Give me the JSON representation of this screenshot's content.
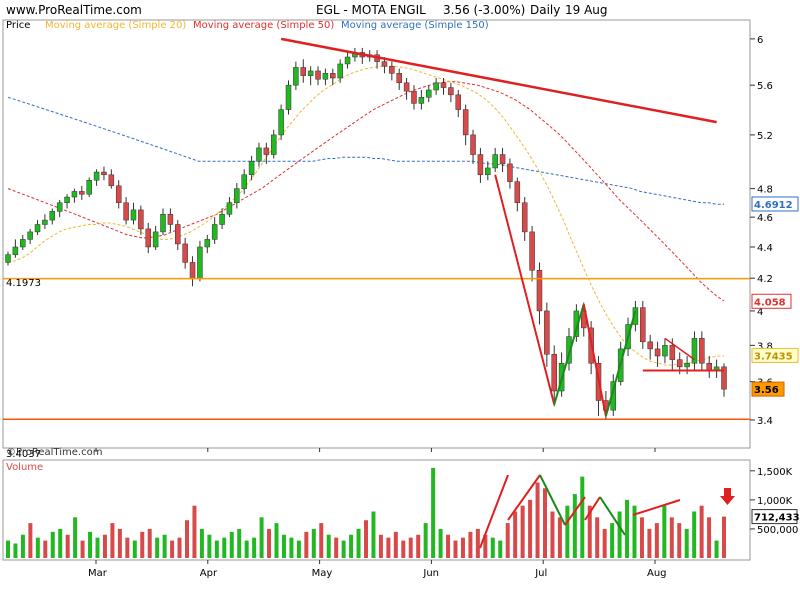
{
  "header": {
    "site": "www.ProRealTime.com",
    "title": "EGL - MOTA ENGIL",
    "price": "3.56 (-3.00%)",
    "period": "Daily",
    "date": "19 Aug"
  },
  "watermark": "©ProRealTime.com",
  "colors": {
    "up": "#22b822",
    "down": "#d84a4a",
    "sma20": "#f0b830",
    "sma50": "#e03030",
    "sma150": "#3070c0",
    "trend": "#e02020",
    "support": "#ff9900",
    "support2": "#ff5500"
  },
  "chart_data": [
    {
      "type": "candlestick",
      "title": "EGL - MOTA ENGIL  3.56 (-3.00%)  Daily  19 Aug",
      "legend": [
        "Price",
        "Moving average (Simple 20)",
        "Moving average (Simple 50)",
        "Moving average (Simple 150)"
      ],
      "x_ticks": [
        "Mar",
        "Apr",
        "May",
        "Jun",
        "Jul",
        "Aug"
      ],
      "y_ticks": [
        "3.4",
        "3.6",
        "3.8",
        "4",
        "4.2",
        "4.4",
        "4.6",
        "4.8",
        "5.2",
        "5.6",
        "6"
      ],
      "ylim": [
        3.3,
        6.08
      ],
      "y_scale": "log",
      "price_labels": [
        {
          "name": "sma150",
          "value": "4.6912"
        },
        {
          "name": "sma50",
          "value": "4.058"
        },
        {
          "name": "sma20",
          "value": "3.7435"
        },
        {
          "name": "last",
          "value": "3.56"
        }
      ],
      "levels": [
        {
          "label": "4.1973",
          "value": 4.1973
        },
        {
          "label": "3.4037",
          "value": 3.4037
        }
      ],
      "sma20": [
        4.3,
        4.31,
        4.33,
        4.36,
        4.4,
        4.44,
        4.47,
        4.5,
        4.52,
        4.53,
        4.54,
        4.55,
        4.55,
        4.56,
        4.56,
        4.55,
        4.54,
        4.52,
        4.5,
        4.48,
        4.46,
        4.45,
        4.45,
        4.46,
        4.48,
        4.5,
        4.53,
        4.56,
        4.6,
        4.64,
        4.68,
        4.73,
        4.78,
        4.85,
        4.92,
        5.0,
        5.08,
        5.16,
        5.24,
        5.31,
        5.38,
        5.44,
        5.5,
        5.55,
        5.59,
        5.63,
        5.67,
        5.7,
        5.72,
        5.74,
        5.75,
        5.76,
        5.76,
        5.76,
        5.75,
        5.74,
        5.72,
        5.7,
        5.68,
        5.66,
        5.64,
        5.62,
        5.6,
        5.57,
        5.54,
        5.5,
        5.45,
        5.39,
        5.32,
        5.24,
        5.16,
        5.08,
        4.99,
        4.9,
        4.8,
        4.69,
        4.58,
        4.46,
        4.35,
        4.24,
        4.14,
        4.05,
        3.97,
        3.9,
        3.84,
        3.79,
        3.76,
        3.73,
        3.71,
        3.7,
        3.69,
        3.69,
        3.7,
        3.7,
        3.71,
        3.72,
        3.73,
        3.74,
        3.74
      ],
      "sma50": [
        4.8,
        4.78,
        4.76,
        4.74,
        4.72,
        4.7,
        4.68,
        4.66,
        4.64,
        4.62,
        4.6,
        4.58,
        4.56,
        4.54,
        4.52,
        4.5,
        4.48,
        4.47,
        4.46,
        4.46,
        4.47,
        4.48,
        4.5,
        4.52,
        4.54,
        4.56,
        4.58,
        4.6,
        4.62,
        4.65,
        4.68,
        4.71,
        4.74,
        4.77,
        4.8,
        4.84,
        4.88,
        4.92,
        4.96,
        5.0,
        5.04,
        5.08,
        5.12,
        5.16,
        5.2,
        5.24,
        5.28,
        5.32,
        5.36,
        5.4,
        5.43,
        5.46,
        5.49,
        5.52,
        5.55,
        5.57,
        5.59,
        5.61,
        5.62,
        5.63,
        5.63,
        5.62,
        5.61,
        5.6,
        5.58,
        5.56,
        5.54,
        5.51,
        5.48,
        5.44,
        5.4,
        5.35,
        5.3,
        5.25,
        5.2,
        5.14,
        5.08,
        5.02,
        4.96,
        4.9,
        4.84,
        4.78,
        4.72,
        4.67,
        4.62,
        4.57,
        4.52,
        4.47,
        4.42,
        4.37,
        4.32,
        4.27,
        4.22,
        4.17,
        4.13,
        4.09,
        4.06
      ],
      "sma150": [
        5.5,
        5.48,
        5.46,
        5.44,
        5.42,
        5.4,
        5.38,
        5.36,
        5.34,
        5.32,
        5.3,
        5.28,
        5.26,
        5.24,
        5.22,
        5.2,
        5.18,
        5.16,
        5.14,
        5.12,
        5.1,
        5.08,
        5.06,
        5.04,
        5.02,
        5.0,
        5.0,
        5.0,
        5.0,
        5.0,
        5.0,
        5.0,
        5.0,
        5.0,
        5.0,
        5.0,
        5.0,
        5.0,
        5.0,
        5.0,
        5.0,
        5.01,
        5.02,
        5.02,
        5.03,
        5.03,
        5.03,
        5.03,
        5.02,
        5.02,
        5.01,
        5.0,
        5.0,
        5.0,
        5.0,
        5.0,
        5.0,
        5.0,
        5.0,
        5.0,
        5.0,
        5.0,
        4.99,
        4.98,
        4.98,
        4.97,
        4.96,
        4.95,
        4.94,
        4.93,
        4.92,
        4.91,
        4.9,
        4.89,
        4.88,
        4.87,
        4.86,
        4.85,
        4.84,
        4.83,
        4.82,
        4.81,
        4.8,
        4.78,
        4.77,
        4.76,
        4.75,
        4.74,
        4.73,
        4.72,
        4.71,
        4.7,
        4.7,
        4.69,
        4.69
      ],
      "candles": [
        [
          4.3,
          4.35,
          4.28,
          4.37
        ],
        [
          4.35,
          4.4,
          4.33,
          4.45
        ],
        [
          4.4,
          4.45,
          4.38,
          4.48
        ],
        [
          4.45,
          4.5,
          4.42,
          4.52
        ],
        [
          4.5,
          4.55,
          4.48,
          4.58
        ],
        [
          4.55,
          4.58,
          4.52,
          4.62
        ],
        [
          4.58,
          4.64,
          4.55,
          4.66
        ],
        [
          4.64,
          4.7,
          4.6,
          4.72
        ],
        [
          4.7,
          4.74,
          4.66,
          4.76
        ],
        [
          4.74,
          4.78,
          4.7,
          4.8
        ],
        [
          4.78,
          4.76,
          4.72,
          4.82
        ],
        [
          4.76,
          4.86,
          4.74,
          4.88
        ],
        [
          4.86,
          4.92,
          4.82,
          4.94
        ],
        [
          4.92,
          4.9,
          4.86,
          4.96
        ],
        [
          4.9,
          4.82,
          4.8,
          4.94
        ],
        [
          4.82,
          4.7,
          4.66,
          4.86
        ],
        [
          4.7,
          4.58,
          4.55,
          4.74
        ],
        [
          4.58,
          4.65,
          4.55,
          4.7
        ],
        [
          4.65,
          4.52,
          4.48,
          4.68
        ],
        [
          4.52,
          4.4,
          4.36,
          4.56
        ],
        [
          4.4,
          4.5,
          4.38,
          4.54
        ],
        [
          4.5,
          4.62,
          4.48,
          4.66
        ],
        [
          4.62,
          4.55,
          4.5,
          4.66
        ],
        [
          4.55,
          4.42,
          4.38,
          4.58
        ],
        [
          4.42,
          4.3,
          4.26,
          4.46
        ],
        [
          4.3,
          4.2,
          4.15,
          4.34
        ],
        [
          4.2,
          4.4,
          4.18,
          4.44
        ],
        [
          4.4,
          4.45,
          4.36,
          4.48
        ],
        [
          4.45,
          4.55,
          4.42,
          4.6
        ],
        [
          4.55,
          4.62,
          4.52,
          4.66
        ],
        [
          4.62,
          4.7,
          4.6,
          4.74
        ],
        [
          4.7,
          4.8,
          4.66,
          4.84
        ],
        [
          4.8,
          4.9,
          4.76,
          4.94
        ],
        [
          4.9,
          5.0,
          4.86,
          5.04
        ],
        [
          5.0,
          5.1,
          4.96,
          5.14
        ],
        [
          5.1,
          5.05,
          4.98,
          5.14
        ],
        [
          5.05,
          5.2,
          5.02,
          5.24
        ],
        [
          5.2,
          5.4,
          5.16,
          5.44
        ],
        [
          5.4,
          5.6,
          5.36,
          5.64
        ],
        [
          5.6,
          5.75,
          5.56,
          5.8
        ],
        [
          5.75,
          5.68,
          5.62,
          5.82
        ],
        [
          5.68,
          5.72,
          5.6,
          5.76
        ],
        [
          5.72,
          5.65,
          5.6,
          5.76
        ],
        [
          5.65,
          5.7,
          5.6,
          5.74
        ],
        [
          5.7,
          5.66,
          5.6,
          5.74
        ],
        [
          5.66,
          5.78,
          5.62,
          5.82
        ],
        [
          5.78,
          5.84,
          5.74,
          5.88
        ],
        [
          5.84,
          5.88,
          5.8,
          5.92
        ],
        [
          5.88,
          5.84,
          5.78,
          5.92
        ],
        [
          5.84,
          5.86,
          5.8,
          5.9
        ],
        [
          5.86,
          5.8,
          5.74,
          5.9
        ],
        [
          5.8,
          5.76,
          5.7,
          5.84
        ],
        [
          5.76,
          5.7,
          5.64,
          5.8
        ],
        [
          5.7,
          5.62,
          5.56,
          5.74
        ],
        [
          5.62,
          5.55,
          5.48,
          5.66
        ],
        [
          5.55,
          5.45,
          5.4,
          5.6
        ],
        [
          5.45,
          5.5,
          5.4,
          5.56
        ],
        [
          5.5,
          5.56,
          5.46,
          5.6
        ],
        [
          5.56,
          5.62,
          5.52,
          5.66
        ],
        [
          5.62,
          5.58,
          5.52,
          5.66
        ],
        [
          5.58,
          5.52,
          5.46,
          5.62
        ],
        [
          5.52,
          5.4,
          5.34,
          5.56
        ],
        [
          5.4,
          5.2,
          5.12,
          5.44
        ],
        [
          5.2,
          5.05,
          4.98,
          5.24
        ],
        [
          5.05,
          4.9,
          4.84,
          5.1
        ],
        [
          4.9,
          4.95,
          4.86,
          5.0
        ],
        [
          4.95,
          5.05,
          4.92,
          5.1
        ],
        [
          5.05,
          4.98,
          4.92,
          5.1
        ],
        [
          4.98,
          4.85,
          4.8,
          5.02
        ],
        [
          4.85,
          4.7,
          4.64,
          4.88
        ],
        [
          4.7,
          4.5,
          4.44,
          4.74
        ],
        [
          4.5,
          4.25,
          4.18,
          4.54
        ],
        [
          4.25,
          4.0,
          3.92,
          4.3
        ],
        [
          4.0,
          3.75,
          3.68,
          4.05
        ],
        [
          3.75,
          3.55,
          3.47,
          3.8
        ],
        [
          3.55,
          3.7,
          3.52,
          3.76
        ],
        [
          3.7,
          3.85,
          3.66,
          3.9
        ],
        [
          3.85,
          4.0,
          3.82,
          4.04
        ],
        [
          4.0,
          3.9,
          3.85,
          4.05
        ],
        [
          3.9,
          3.7,
          3.64,
          3.94
        ],
        [
          3.7,
          3.5,
          3.42,
          3.74
        ],
        [
          3.5,
          3.45,
          3.4,
          3.55
        ],
        [
          3.45,
          3.6,
          3.42,
          3.64
        ],
        [
          3.6,
          3.78,
          3.58,
          3.82
        ],
        [
          3.78,
          3.92,
          3.74,
          3.96
        ],
        [
          3.92,
          4.02,
          3.88,
          4.06
        ],
        [
          4.02,
          3.82,
          3.78,
          4.06
        ],
        [
          3.82,
          3.78,
          3.72,
          3.86
        ],
        [
          3.78,
          3.74,
          3.68,
          3.82
        ],
        [
          3.74,
          3.8,
          3.7,
          3.84
        ],
        [
          3.8,
          3.72,
          3.66,
          3.84
        ],
        [
          3.72,
          3.68,
          3.64,
          3.76
        ],
        [
          3.68,
          3.7,
          3.64,
          3.74
        ],
        [
          3.7,
          3.84,
          3.66,
          3.88
        ],
        [
          3.84,
          3.7,
          3.66,
          3.88
        ],
        [
          3.7,
          3.66,
          3.62,
          3.74
        ],
        [
          3.66,
          3.68,
          3.62,
          3.72
        ],
        [
          3.68,
          3.56,
          3.52,
          3.7
        ]
      ]
    },
    {
      "type": "bar",
      "title": "Volume",
      "y_ticks": [
        "500,000",
        "1,000K",
        "1,500K"
      ],
      "ylim": [
        0,
        1600000
      ],
      "last_label": "712,433",
      "values": [
        300000,
        250000,
        400000,
        600000,
        350000,
        300000,
        450000,
        500000,
        400000,
        700000,
        300000,
        450000,
        350000,
        400000,
        600000,
        500000,
        350000,
        300000,
        450000,
        500000,
        350000,
        400000,
        300000,
        350000,
        650000,
        900000,
        500000,
        400000,
        300000,
        350000,
        450000,
        500000,
        300000,
        350000,
        700000,
        500000,
        600000,
        400000,
        350000,
        300000,
        450000,
        500000,
        600000,
        400000,
        350000,
        300000,
        400000,
        500000,
        650000,
        800000,
        400000,
        350000,
        450000,
        300000,
        350000,
        400000,
        600000,
        1550000,
        500000,
        400000,
        300000,
        350000,
        450000,
        500000,
        400000,
        350000,
        300000,
        600000,
        800000,
        900000,
        1000000,
        1300000,
        1200000,
        800000,
        700000,
        900000,
        1100000,
        1400000,
        900000,
        700000,
        500000,
        600000,
        800000,
        1000000,
        900000,
        700000,
        500000,
        600000,
        900000,
        700000,
        600000,
        500000,
        800000,
        900000,
        700000,
        300000,
        712433
      ],
      "up": [
        1,
        1,
        1,
        0,
        1,
        0,
        1,
        1,
        0,
        1,
        0,
        1,
        1,
        0,
        0,
        0,
        0,
        1,
        0,
        0,
        1,
        1,
        0,
        0,
        0,
        0,
        1,
        1,
        1,
        1,
        1,
        1,
        1,
        1,
        1,
        0,
        1,
        1,
        1,
        1,
        0,
        1,
        0,
        1,
        0,
        1,
        1,
        1,
        0,
        1,
        0,
        0,
        0,
        0,
        0,
        0,
        1,
        1,
        1,
        0,
        0,
        0,
        0,
        0,
        0,
        1,
        1,
        0,
        0,
        0,
        0,
        0,
        0,
        0,
        0,
        1,
        1,
        1,
        0,
        0,
        0,
        1,
        1,
        1,
        1,
        0,
        0,
        0,
        1,
        0,
        0,
        1,
        1,
        0,
        0,
        1,
        0
      ]
    }
  ]
}
